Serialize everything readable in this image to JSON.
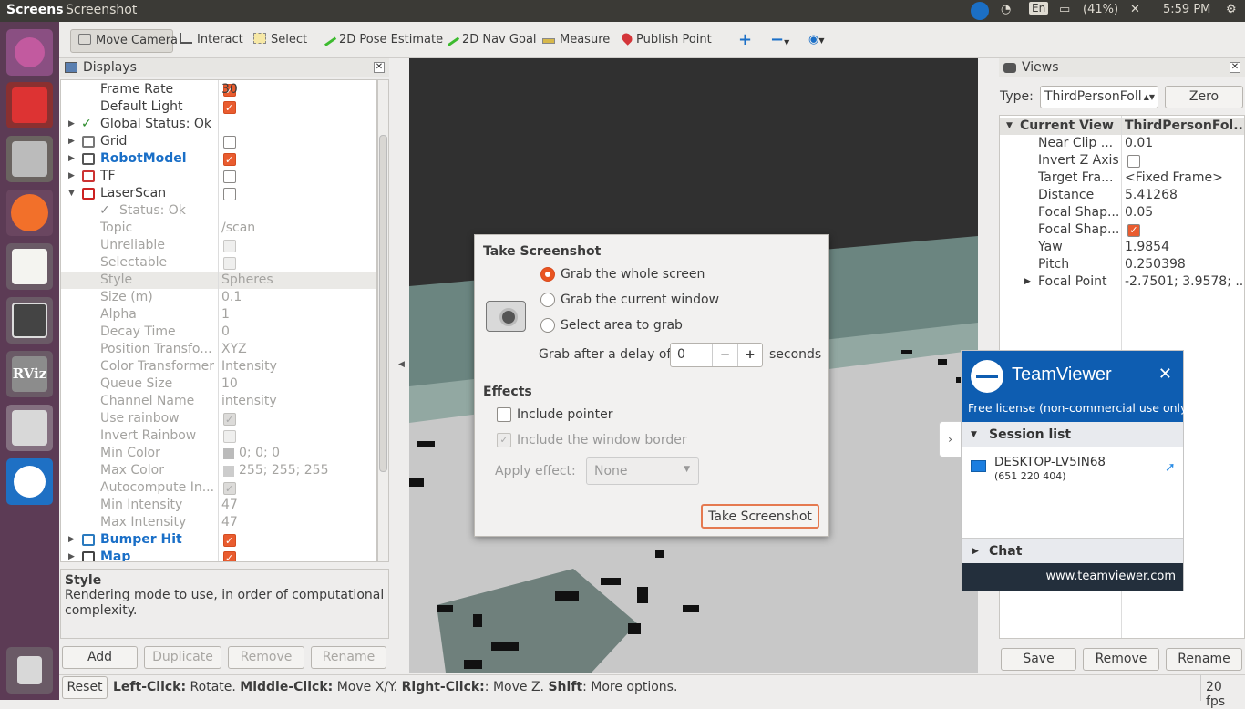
{
  "topbar": {
    "app_name": "Screens",
    "window_title": "Screenshot",
    "lang": "En",
    "battery": "(41%)",
    "time": "5:59 PM"
  },
  "launcher": {
    "items": [
      "ubuntu-icon",
      "terminal-icon",
      "files-icon",
      "firefox-icon",
      "text-editor-icon",
      "workspace-icon",
      "rviz-icon",
      "screenshot-icon",
      "teamviewer-icon",
      "trash-icon"
    ],
    "rviz_label": "RViz"
  },
  "toolbar": {
    "move_camera": "Move Camera",
    "interact": "Interact",
    "select": "Select",
    "pose_estimate": "2D Pose Estimate",
    "nav_goal": "2D Nav Goal",
    "measure": "Measure",
    "publish_point": "Publish Point"
  },
  "displays": {
    "title": "Displays",
    "rows": [
      {
        "name": "Frame Rate",
        "value": "30"
      },
      {
        "name": "Default Light",
        "value": ""
      },
      {
        "name": "Global Status: Ok",
        "value": ""
      },
      {
        "name": "Grid",
        "value": ""
      },
      {
        "name": "RobotModel",
        "value": ""
      },
      {
        "name": "TF",
        "value": ""
      },
      {
        "name": "LaserScan",
        "value": ""
      },
      {
        "name": "Status: Ok",
        "value": ""
      },
      {
        "name": "Topic",
        "value": "/scan"
      },
      {
        "name": "Unreliable",
        "value": ""
      },
      {
        "name": "Selectable",
        "value": ""
      },
      {
        "name": "Style",
        "value": "Spheres"
      },
      {
        "name": "Size (m)",
        "value": "0.1"
      },
      {
        "name": "Alpha",
        "value": "1"
      },
      {
        "name": "Decay Time",
        "value": "0"
      },
      {
        "name": "Position Transfo...",
        "value": "XYZ"
      },
      {
        "name": "Color Transformer",
        "value": "Intensity"
      },
      {
        "name": "Queue Size",
        "value": "10"
      },
      {
        "name": "Channel Name",
        "value": "intensity"
      },
      {
        "name": "Use rainbow",
        "value": ""
      },
      {
        "name": "Invert Rainbow",
        "value": ""
      },
      {
        "name": "Min Color",
        "value": "0; 0; 0"
      },
      {
        "name": "Max Color",
        "value": "255; 255; 255"
      },
      {
        "name": "Autocompute In...",
        "value": ""
      },
      {
        "name": "Min Intensity",
        "value": "47"
      },
      {
        "name": "Max Intensity",
        "value": "47"
      },
      {
        "name": "Bumper Hit",
        "value": ""
      },
      {
        "name": "Map",
        "value": ""
      }
    ],
    "desc_title": "Style",
    "desc_text": "Rendering mode to use, in order of computational complexity.",
    "buttons": {
      "add": "Add",
      "duplicate": "Duplicate",
      "remove": "Remove",
      "rename": "Rename"
    }
  },
  "views": {
    "title": "Views",
    "type_label": "Type:",
    "type_value": "ThirdPersonFoll",
    "zero": "Zero",
    "header_name": "Current View",
    "header_value": "ThirdPersonFol...",
    "rows": [
      {
        "name": "Near Clip ...",
        "value": "0.01"
      },
      {
        "name": "Invert Z Axis",
        "value": ""
      },
      {
        "name": "Target Fra...",
        "value": "<Fixed Frame>"
      },
      {
        "name": "Distance",
        "value": "5.41268"
      },
      {
        "name": "Focal Shap...",
        "value": "0.05"
      },
      {
        "name": "Focal Shap...",
        "value": ""
      },
      {
        "name": "Yaw",
        "value": "1.9854"
      },
      {
        "name": "Pitch",
        "value": "0.250398"
      },
      {
        "name": "Focal Point",
        "value": "-2.7501; 3.9578; ..."
      }
    ],
    "buttons": {
      "save": "Save",
      "remove": "Remove",
      "rename": "Rename"
    }
  },
  "dialog": {
    "title": "Take Screenshot",
    "opt_whole": "Grab the whole screen",
    "opt_window": "Grab the current window",
    "opt_area": "Select area to grab",
    "delay_label": "Grab after a delay of",
    "delay_value": "0",
    "delay_unit": "seconds",
    "effects": "Effects",
    "include_pointer": "Include pointer",
    "include_border": "Include the window border",
    "apply_effect": "Apply effect:",
    "effect_value": "None",
    "take_button": "Take Screenshot"
  },
  "teamviewer": {
    "brand": "TeamViewer",
    "license": "Free license (non-commercial use only)",
    "session_list": "Session list",
    "device": "DESKTOP-LV5IN68",
    "device_id": "(651 220 404)",
    "chat": "Chat",
    "url": "www.teamviewer.com"
  },
  "status": {
    "reset": "Reset",
    "left_click": "Left-Click:",
    "left_desc": " Rotate. ",
    "middle_click": "Middle-Click:",
    "middle_desc": " Move X/Y. ",
    "right_click": "Right-Click:",
    "right_desc": ": Move Z. ",
    "shift": "Shift",
    "shift_desc": ": More options.",
    "fps": "20 fps"
  },
  "colors": {
    "accent": "#e95420",
    "launcher": "#5c3b55",
    "teamviewer": "#0e5db1"
  }
}
